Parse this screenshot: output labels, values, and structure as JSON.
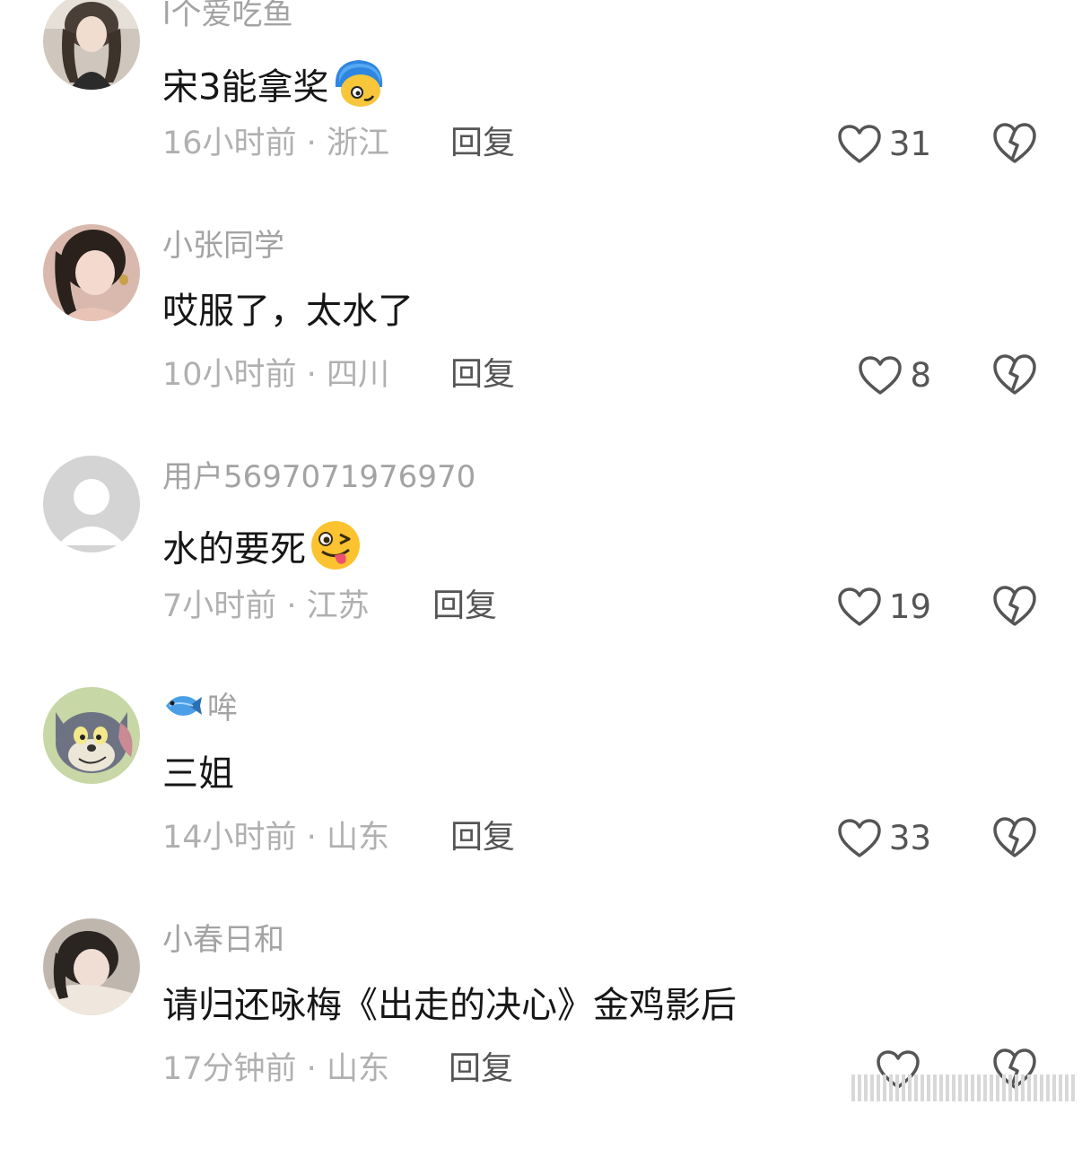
{
  "comments": [
    {
      "username": "l个爱吃鱼",
      "text": "宋3能拿奖",
      "emoji": "blue-haired-face-emoji",
      "time": "16小时前",
      "location": "浙江",
      "reply_label": "回复",
      "likes": "31"
    },
    {
      "username": "小张同学",
      "text": "哎服了，太水了",
      "time": "10小时前",
      "location": "四川",
      "reply_label": "回复",
      "likes": "8"
    },
    {
      "username": "用户5697071976970",
      "text": "水的要死",
      "emoji": "winking-tongue-face-emoji",
      "time": "7小时前",
      "location": "江苏",
      "reply_label": "回复",
      "likes": "19"
    },
    {
      "username": "哞",
      "username_icon": "fish-icon",
      "text": "三姐",
      "time": "14小时前",
      "location": "山东",
      "reply_label": "回复",
      "likes": "33"
    },
    {
      "username": "小春日和",
      "text": "请归还咏梅《出走的决心》金鸡影后",
      "time": "17分钟前",
      "location": "山东",
      "reply_label": "回复",
      "likes": ""
    }
  ],
  "separator": " · ",
  "colors": {
    "username": "#a3a3a3",
    "content": "#161616",
    "meta": "#b0b0b0",
    "action": "#555555"
  }
}
